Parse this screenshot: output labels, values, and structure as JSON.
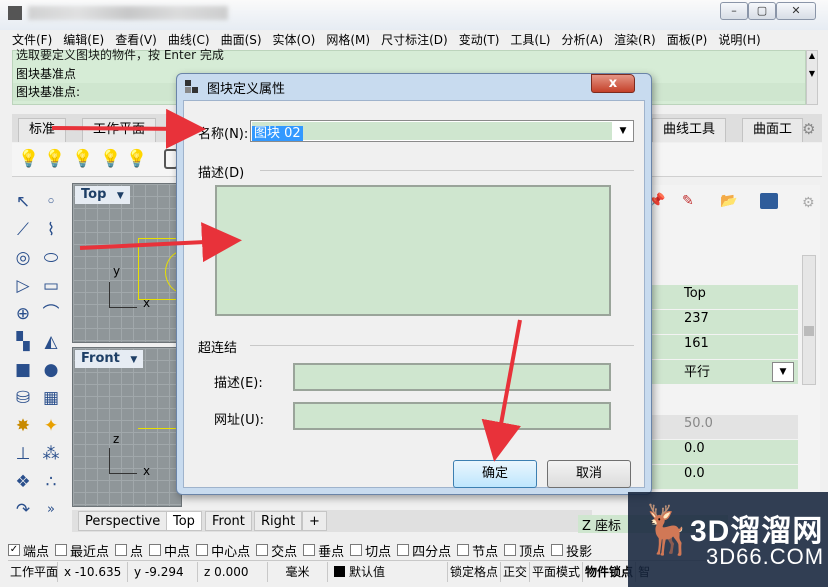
{
  "menu": [
    "文件(F)",
    "编辑(E)",
    "查看(V)",
    "曲线(C)",
    "曲面(S)",
    "实体(O)",
    "网格(M)",
    "尺寸标注(D)",
    "变动(T)",
    "工具(L)",
    "分析(A)",
    "渲染(R)",
    "面板(P)",
    "说明(H)"
  ],
  "command": {
    "line1": "选取要定义图块的物件，按 Enter 完成",
    "line2": "图块基准点",
    "line3": "图块基准点:"
  },
  "toolbar_tabs": [
    "标准",
    "工作平面",
    "曲线工具",
    "曲面工"
  ],
  "viewports": {
    "top": "Top",
    "front": "Front",
    "axis_y": "y",
    "axis_x": "x",
    "axis_z": "z"
  },
  "viewport_tabs": [
    "Perspective",
    "Top",
    "Front",
    "Right"
  ],
  "right_panel": {
    "values": [
      "Top",
      "237",
      "161",
      "平行",
      "50.0",
      "0.0",
      "0.0"
    ],
    "bottom_label": "Z 座标"
  },
  "snap_options": [
    {
      "label": "端点",
      "checked": true
    },
    {
      "label": "最近点",
      "checked": false
    },
    {
      "label": "点",
      "checked": false
    },
    {
      "label": "中点",
      "checked": false
    },
    {
      "label": "中心点",
      "checked": false
    },
    {
      "label": "交点",
      "checked": false
    },
    {
      "label": "垂点",
      "checked": false
    },
    {
      "label": "切点",
      "checked": false
    },
    {
      "label": "四分点",
      "checked": false
    },
    {
      "label": "节点",
      "checked": false
    },
    {
      "label": "顶点",
      "checked": false
    },
    {
      "label": "投影",
      "checked": false
    }
  ],
  "status": {
    "cplane": "工作平面",
    "x": "x -10.635",
    "y": "y -9.294",
    "z": "z 0.000",
    "unit": "毫米",
    "layer": "默认值",
    "grid_snap": "锁定格点",
    "ortho": "正交",
    "planar": "平面模式",
    "osnap": "物件锁点",
    "smart": "智"
  },
  "dialog": {
    "title": "图块定义属性",
    "close_label": "x",
    "name_label": "名称(N):",
    "name_value": "图块 02",
    "description_label": "描述(D)",
    "hyperlink_label": "超连结",
    "link_desc_label": "描述(E):",
    "url_label": "网址(U):",
    "ok_label": "确定",
    "cancel_label": "取消"
  },
  "watermark": {
    "main": "3D溜溜网",
    "sub": "3D66.COM"
  },
  "colors": {
    "command_bg": "#d6ecd6",
    "field_bg": "#cfe6cf",
    "arrow": "#e8323a",
    "dialog_frame": "#c8dbef"
  }
}
